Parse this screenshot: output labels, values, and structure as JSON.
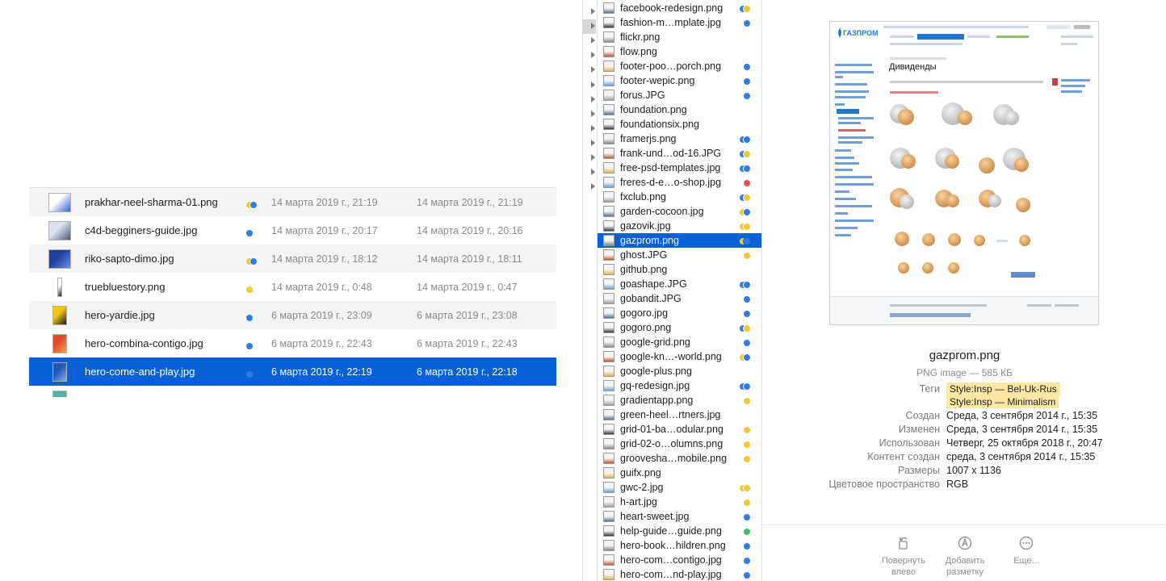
{
  "left_list": {
    "rows": [
      {
        "name": "prakhar-neel-sharma-01.png",
        "tags": [
          "yellow",
          "blue"
        ],
        "created": "14 марта 2019 г., 21:19",
        "modified": "14 марта 2019 г., 21:19"
      },
      {
        "name": "c4d-begginers-guide.jpg",
        "tags": [
          "blue"
        ],
        "created": "14 марта 2019 г., 20:17",
        "modified": "14 марта 2019 г., 20:16"
      },
      {
        "name": "riko-sapto-dimo.jpg",
        "tags": [
          "yellow",
          "blue"
        ],
        "created": "14 марта 2019 г., 18:12",
        "modified": "14 марта 2019 г., 18:11"
      },
      {
        "name": "truebluestory.png",
        "tags": [
          "yellow"
        ],
        "created": "14 марта 2019 г., 0:48",
        "modified": "14 марта 2019 г., 0:47"
      },
      {
        "name": "hero-yardie.jpg",
        "tags": [
          "blue"
        ],
        "created": "6 марта 2019 г., 23:09",
        "modified": "6 марта 2019 г., 23:08"
      },
      {
        "name": "hero-combina-contigo.jpg",
        "tags": [
          "blue"
        ],
        "created": "6 марта 2019 г., 22:43",
        "modified": "6 марта 2019 г., 22:43"
      },
      {
        "name": "hero-come-and-play.jpg",
        "tags": [
          "blue"
        ],
        "created": "6 марта 2019 г., 22:19",
        "modified": "6 марта 2019 г., 22:18"
      }
    ]
  },
  "column": {
    "items": [
      {
        "name": "facebook-redesign.png",
        "tags": [
          "blue",
          "yellow"
        ]
      },
      {
        "name": "fashion-m…mplate.jpg",
        "tags": [
          "blue"
        ]
      },
      {
        "name": "flickr.png",
        "tags": []
      },
      {
        "name": "flow.png",
        "tags": []
      },
      {
        "name": "footer-poo…porch.png",
        "tags": [
          "blue"
        ]
      },
      {
        "name": "footer-wepic.png",
        "tags": [
          "blue"
        ]
      },
      {
        "name": "forus.JPG",
        "tags": [
          "blue"
        ]
      },
      {
        "name": "foundation.png",
        "tags": []
      },
      {
        "name": "foundationsix.png",
        "tags": []
      },
      {
        "name": "framerjs.png",
        "tags": [
          "blue",
          "blue"
        ]
      },
      {
        "name": "frank-und…od-16.JPG",
        "tags": [
          "blue",
          "yellow"
        ]
      },
      {
        "name": "free-psd-templates.jpg",
        "tags": [
          "blue",
          "blue"
        ]
      },
      {
        "name": "freres-d-e…o-shop.jpg",
        "tags": [
          "red"
        ]
      },
      {
        "name": "fxclub.png",
        "tags": [
          "blue",
          "yellow"
        ]
      },
      {
        "name": "garden-cocoon.jpg",
        "tags": [
          "yellow",
          "blue"
        ]
      },
      {
        "name": "gazovik.jpg",
        "tags": [
          "yellow",
          "yellow"
        ]
      },
      {
        "name": "gazprom.png",
        "tags": [
          "yellow",
          "blue"
        ]
      },
      {
        "name": "ghost.JPG",
        "tags": [
          "yellow"
        ]
      },
      {
        "name": "github.png",
        "tags": []
      },
      {
        "name": "goashape.JPG",
        "tags": [
          "blue",
          "blue"
        ]
      },
      {
        "name": "gobandit.JPG",
        "tags": [
          "blue"
        ]
      },
      {
        "name": "gogoro.jpg",
        "tags": [
          "blue"
        ]
      },
      {
        "name": "gogoro.png",
        "tags": [
          "blue",
          "yellow"
        ]
      },
      {
        "name": "google-grid.png",
        "tags": [
          "blue"
        ]
      },
      {
        "name": "google-kn…-world.png",
        "tags": [
          "yellow",
          "blue"
        ]
      },
      {
        "name": "google-plus.png",
        "tags": []
      },
      {
        "name": "gq-redesign.jpg",
        "tags": [
          "blue",
          "blue"
        ]
      },
      {
        "name": "gradientapp.png",
        "tags": [
          "yellow"
        ]
      },
      {
        "name": "green-heel…rtners.jpg",
        "tags": []
      },
      {
        "name": "grid-01-ba…odular.png",
        "tags": [
          "yellow"
        ]
      },
      {
        "name": "grid-02-o…olumns.png",
        "tags": [
          "yellow"
        ]
      },
      {
        "name": "groovesha…mobile.png",
        "tags": [
          "yellow"
        ]
      },
      {
        "name": "guifx.png",
        "tags": []
      },
      {
        "name": "gwc-2.jpg",
        "tags": [
          "yellow",
          "yellow"
        ]
      },
      {
        "name": "h-art.jpg",
        "tags": [
          "yellow"
        ]
      },
      {
        "name": "heart-sweet.jpg",
        "tags": [
          "blue"
        ]
      },
      {
        "name": "help-guide…guide.png",
        "tags": [
          "green"
        ]
      },
      {
        "name": "hero-book…hildren.png",
        "tags": [
          "blue"
        ]
      },
      {
        "name": "hero-com…contigo.jpg",
        "tags": [
          "blue"
        ]
      },
      {
        "name": "hero-com…nd-play.jpg",
        "tags": [
          "blue"
        ]
      }
    ]
  },
  "preview": {
    "filename": "gazprom.png",
    "kind": "PNG image — 585 КБ",
    "tags_label": "Теги",
    "tags": [
      "Style:Insp — Bel-Uk-Rus",
      "Style:Insp — Minimalism"
    ],
    "meta": [
      {
        "label": "Создан",
        "value": "Среда, 3 сентября 2014 г., 15:35"
      },
      {
        "label": "Изменен",
        "value": "Среда, 3 сентября 2014 г., 15:35"
      },
      {
        "label": "Использован",
        "value": "Четверг, 25 октября 2018 г., 20:47"
      },
      {
        "label": "Контент создан",
        "value": "среда, 3 сентября 2014 г., 15:35"
      },
      {
        "label": "Размеры",
        "value": "1007 x 1136"
      },
      {
        "label": "Цветовое пространство",
        "value": "RGB"
      }
    ],
    "actions": {
      "rotate": "Повернуть влево",
      "markup": "Добавить разметку",
      "more": "Еще..."
    },
    "page": {
      "brand": "ГАЗПРОМ",
      "heading": "Дивиденды"
    }
  },
  "colors": {
    "selection": "#0a60d6",
    "tag_blue": "#2f7be8",
    "tag_yellow": "#f2c833",
    "tag_red": "#ee4b4b",
    "tag_green": "#3cc45a",
    "tag_pill": "#fbe6a4"
  }
}
